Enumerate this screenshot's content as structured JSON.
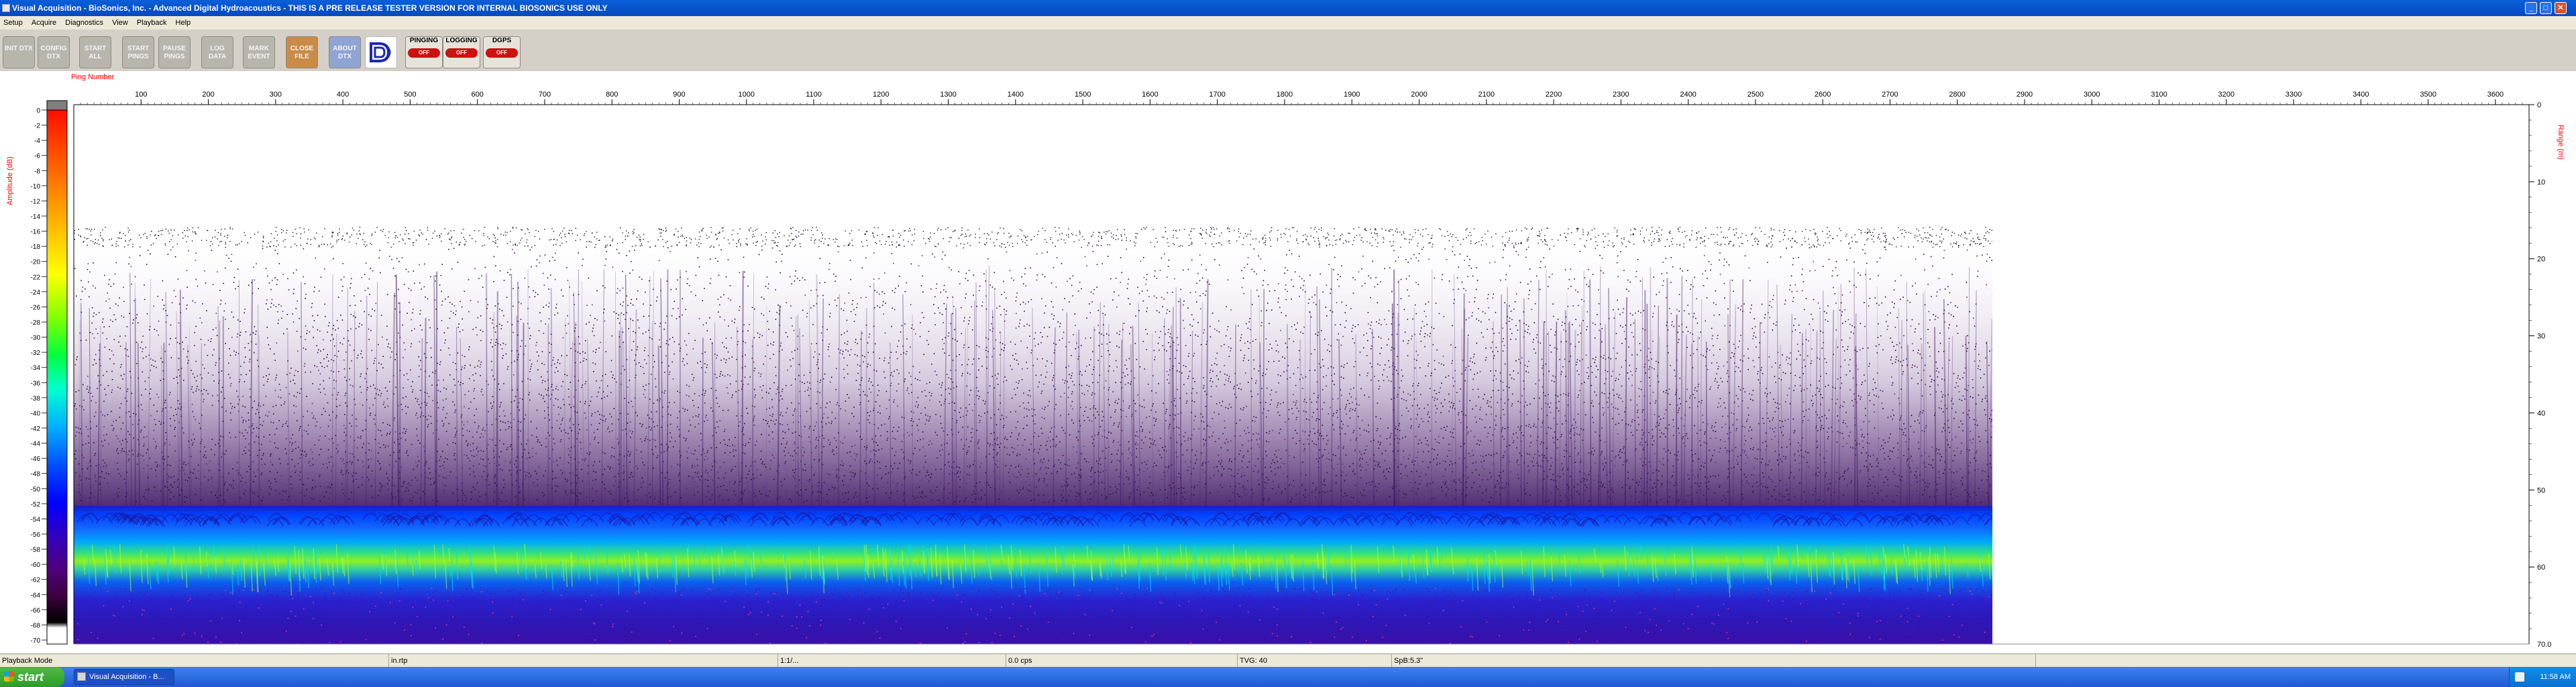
{
  "window": {
    "title": "Visual Acquisition  -  BioSonics, Inc.  -  Advanced Digital Hydroacoustics  -  THIS IS A PRE RELEASE TESTER VERSION FOR INTERNAL BIOSONICS USE ONLY",
    "min_glyph": "_",
    "max_glyph": "□",
    "close_glyph": "✕"
  },
  "menu": [
    "Setup",
    "Acquire",
    "Diagnostics",
    "View",
    "Playback",
    "Help"
  ],
  "toolbar": {
    "buttons": [
      {
        "label": "INIT DTX"
      },
      {
        "label": "CONFIG DTX"
      },
      {
        "label": "START ALL"
      },
      {
        "label": "START PINGS"
      },
      {
        "label": "PAUSE PINGS"
      },
      {
        "label": "LOG DATA"
      },
      {
        "label": "MARK EVENT"
      },
      {
        "label": "CLOSE FILE"
      },
      {
        "label": "ABOUT DTX"
      }
    ],
    "logo_icon": "biosonics-logo-icon",
    "indicators": [
      {
        "label": "PINGING",
        "state": "OFF"
      },
      {
        "label": "LOGGING",
        "state": "OFF"
      },
      {
        "label": "DGPS",
        "state": "OFF"
      }
    ]
  },
  "echogram": {
    "ping_axis_label": "Ping Number",
    "ping_ticks": [
      "100",
      "200",
      "300",
      "400",
      "500",
      "600",
      "700",
      "800",
      "900",
      "1000",
      "1100",
      "1200",
      "1300",
      "1400",
      "1500",
      "1600",
      "1700",
      "1800",
      "1900",
      "2000",
      "2100",
      "2200",
      "2300",
      "2400",
      "2500",
      "2600",
      "2700",
      "2800",
      "2900",
      "3000",
      "3100",
      "3200",
      "3300",
      "3400",
      "3500",
      "3600"
    ],
    "ping_max": 3650,
    "data_end_ping": 2860,
    "amp_axis_label": "Amplitude (dB)",
    "amp_ticks": [
      "0",
      "-2",
      "-4",
      "-6",
      "-8",
      "-10",
      "-12",
      "-14",
      "-16",
      "-18",
      "-20",
      "-22",
      "-24",
      "-26",
      "-28",
      "-30",
      "-32",
      "-34",
      "-36",
      "-38",
      "-40",
      "-42",
      "-44",
      "-46",
      "-48",
      "-50",
      "-52",
      "-54",
      "-56",
      "-58",
      "-60",
      "-62",
      "-64",
      "-66",
      "-68",
      "-70"
    ],
    "range_axis_label": "Range (m)",
    "range_ticks": [
      "0",
      "10",
      "20",
      "30",
      "40",
      "50",
      "60"
    ],
    "range_end_label": "70.0",
    "range_max": 70,
    "colors": {
      "accent_red": "#ff0000",
      "scale": [
        "#7f7f7f",
        "#ff0000",
        "#ff3a00",
        "#ff8000",
        "#ffc000",
        "#ffff00",
        "#b0ff00",
        "#00ff00",
        "#00ff90",
        "#00ffff",
        "#00a8ff",
        "#0050ff",
        "#0000ff",
        "#2a00c8",
        "#4a0090",
        "#4a004a",
        "#2a002a",
        "#000000",
        "#ffffff"
      ]
    }
  },
  "statusbar": {
    "mode": "Playback Mode",
    "file": "in.rtp",
    "field3": "1:1/...",
    "field4": "0.0 cps",
    "field5": "TVG: 40",
    "field6": "SpB:5.3\""
  },
  "taskbar": {
    "start_label": "start",
    "task_label": "Visual Acquisition - B...",
    "clock": "11:58 AM"
  }
}
